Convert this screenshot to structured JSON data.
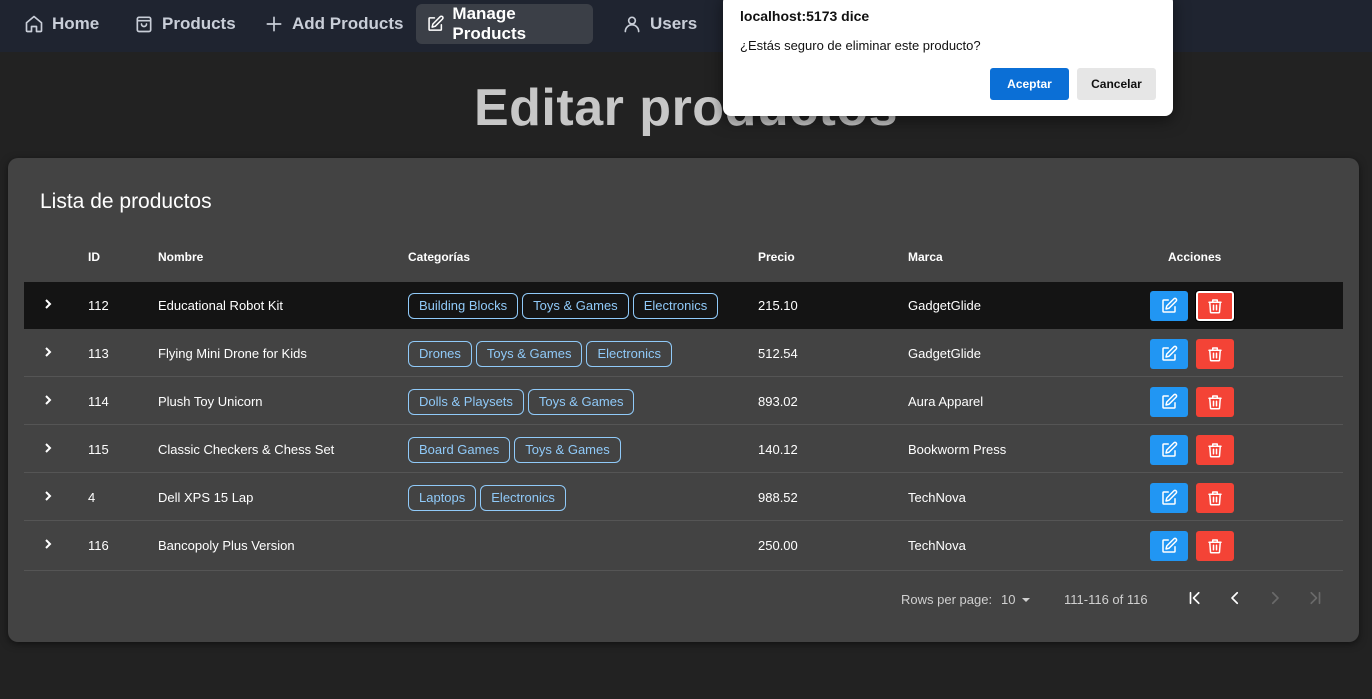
{
  "nav": {
    "items": [
      {
        "label": "Home",
        "icon": "home-icon"
      },
      {
        "label": "Products",
        "icon": "bag-icon"
      },
      {
        "label": "Add Products",
        "icon": "plus-icon"
      },
      {
        "label": "Manage Products",
        "icon": "edit-icon",
        "active": true
      },
      {
        "label": "Users",
        "icon": "user-icon"
      }
    ]
  },
  "page": {
    "title": "Editar productos"
  },
  "card": {
    "title": "Lista de productos",
    "columns": {
      "id": "ID",
      "name": "Nombre",
      "categories": "Categorías",
      "price": "Precio",
      "brand": "Marca",
      "actions": "Acciones"
    },
    "rows": [
      {
        "id": "112",
        "name": "Educational Robot Kit",
        "categories": [
          "Building Blocks",
          "Toys & Games",
          "Electronics"
        ],
        "price": "215.10",
        "brand": "GadgetGlide"
      },
      {
        "id": "113",
        "name": "Flying Mini Drone for Kids",
        "categories": [
          "Drones",
          "Toys & Games",
          "Electronics"
        ],
        "price": "512.54",
        "brand": "GadgetGlide"
      },
      {
        "id": "114",
        "name": "Plush Toy Unicorn",
        "categories": [
          "Dolls & Playsets",
          "Toys & Games"
        ],
        "price": "893.02",
        "brand": "Aura Apparel"
      },
      {
        "id": "115",
        "name": "Classic Checkers & Chess Set",
        "categories": [
          "Board Games",
          "Toys & Games"
        ],
        "price": "140.12",
        "brand": "Bookworm Press"
      },
      {
        "id": "4",
        "name": "Dell XPS 15 Lap",
        "categories": [
          "Laptops",
          "Electronics"
        ],
        "price": "988.52",
        "brand": "TechNova"
      },
      {
        "id": "116",
        "name": "Bancopoly Plus Version",
        "categories": [],
        "price": "250.00",
        "brand": "TechNova"
      }
    ],
    "pagination": {
      "rows_per_page_label": "Rows per page:",
      "rows_per_page": "10",
      "range": "111-116 of 116"
    }
  },
  "dialog": {
    "title": "localhost:5173 dice",
    "message": "¿Estás seguro de eliminar este producto?",
    "ok_label": "Aceptar",
    "cancel_label": "Cancelar"
  },
  "colors": {
    "chip": "#90caf9",
    "edit_button": "#2196f3",
    "delete_button": "#f44336",
    "dialog_primary": "#0b6fd6"
  }
}
